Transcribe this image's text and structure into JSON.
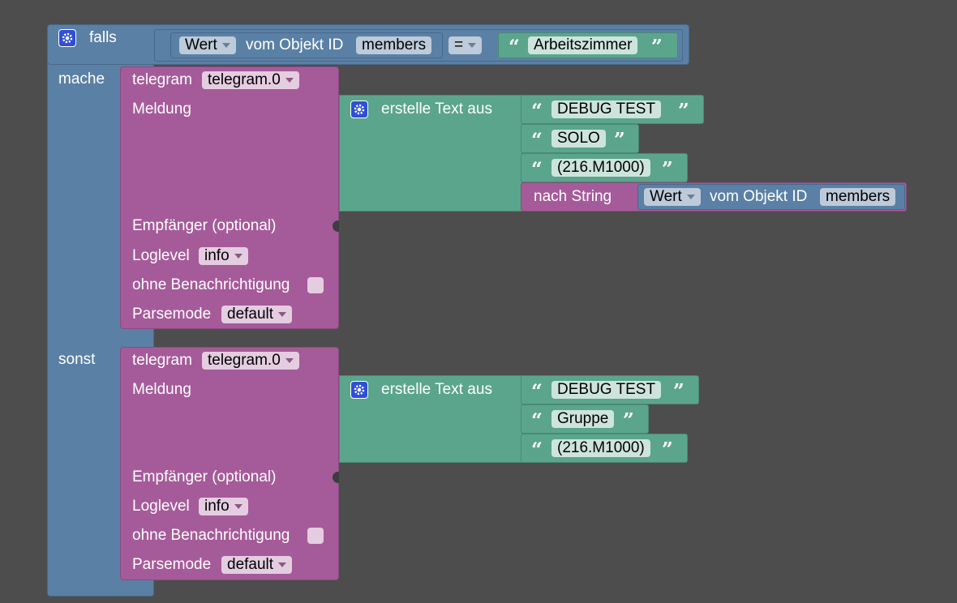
{
  "if_block": {
    "falls_label": "falls",
    "mache_label": "mache",
    "sonst_label": "sonst",
    "condition": {
      "value_dropdown": "Wert",
      "object_label": "vom Objekt ID",
      "object_id": "members",
      "operator": "=",
      "compare_text": "Arbeitszimmer"
    }
  },
  "telegram_blocks": [
    {
      "title_label": "telegram",
      "instance": "telegram.0",
      "message_label": "Meldung",
      "recipient_label": "Empfänger (optional)",
      "loglevel_label": "Loglevel",
      "loglevel_value": "info",
      "silent_label": "ohne Benachrichtigung",
      "parsemode_label": "Parsemode",
      "parsemode_value": "default",
      "text_block": {
        "label": "erstelle Text aus",
        "strings": [
          "DEBUG TEST",
          "SOLO",
          "(216.M1000)"
        ],
        "to_string_label": "nach String",
        "value_dropdown": "Wert",
        "object_label": "vom Objekt ID",
        "object_id": "members"
      }
    },
    {
      "title_label": "telegram",
      "instance": "telegram.0",
      "message_label": "Meldung",
      "recipient_label": "Empfänger (optional)",
      "loglevel_label": "Loglevel",
      "loglevel_value": "info",
      "silent_label": "ohne Benachrichtigung",
      "parsemode_label": "Parsemode",
      "parsemode_value": "default",
      "text_block": {
        "label": "erstelle Text aus",
        "strings": [
          "DEBUG TEST",
          "Gruppe",
          "(216.M1000)"
        ]
      }
    }
  ],
  "colors": {
    "workspace": "#4d4d4d",
    "logic_block": "#5b80a5",
    "telegram_block": "#a55b99",
    "text_block": "#5ba58c",
    "mutator_gear": "#2f4fd6"
  },
  "icons": [
    "gear-icon",
    "dropdown-arrow-icon",
    "quote-open-icon",
    "quote-close-icon"
  ]
}
